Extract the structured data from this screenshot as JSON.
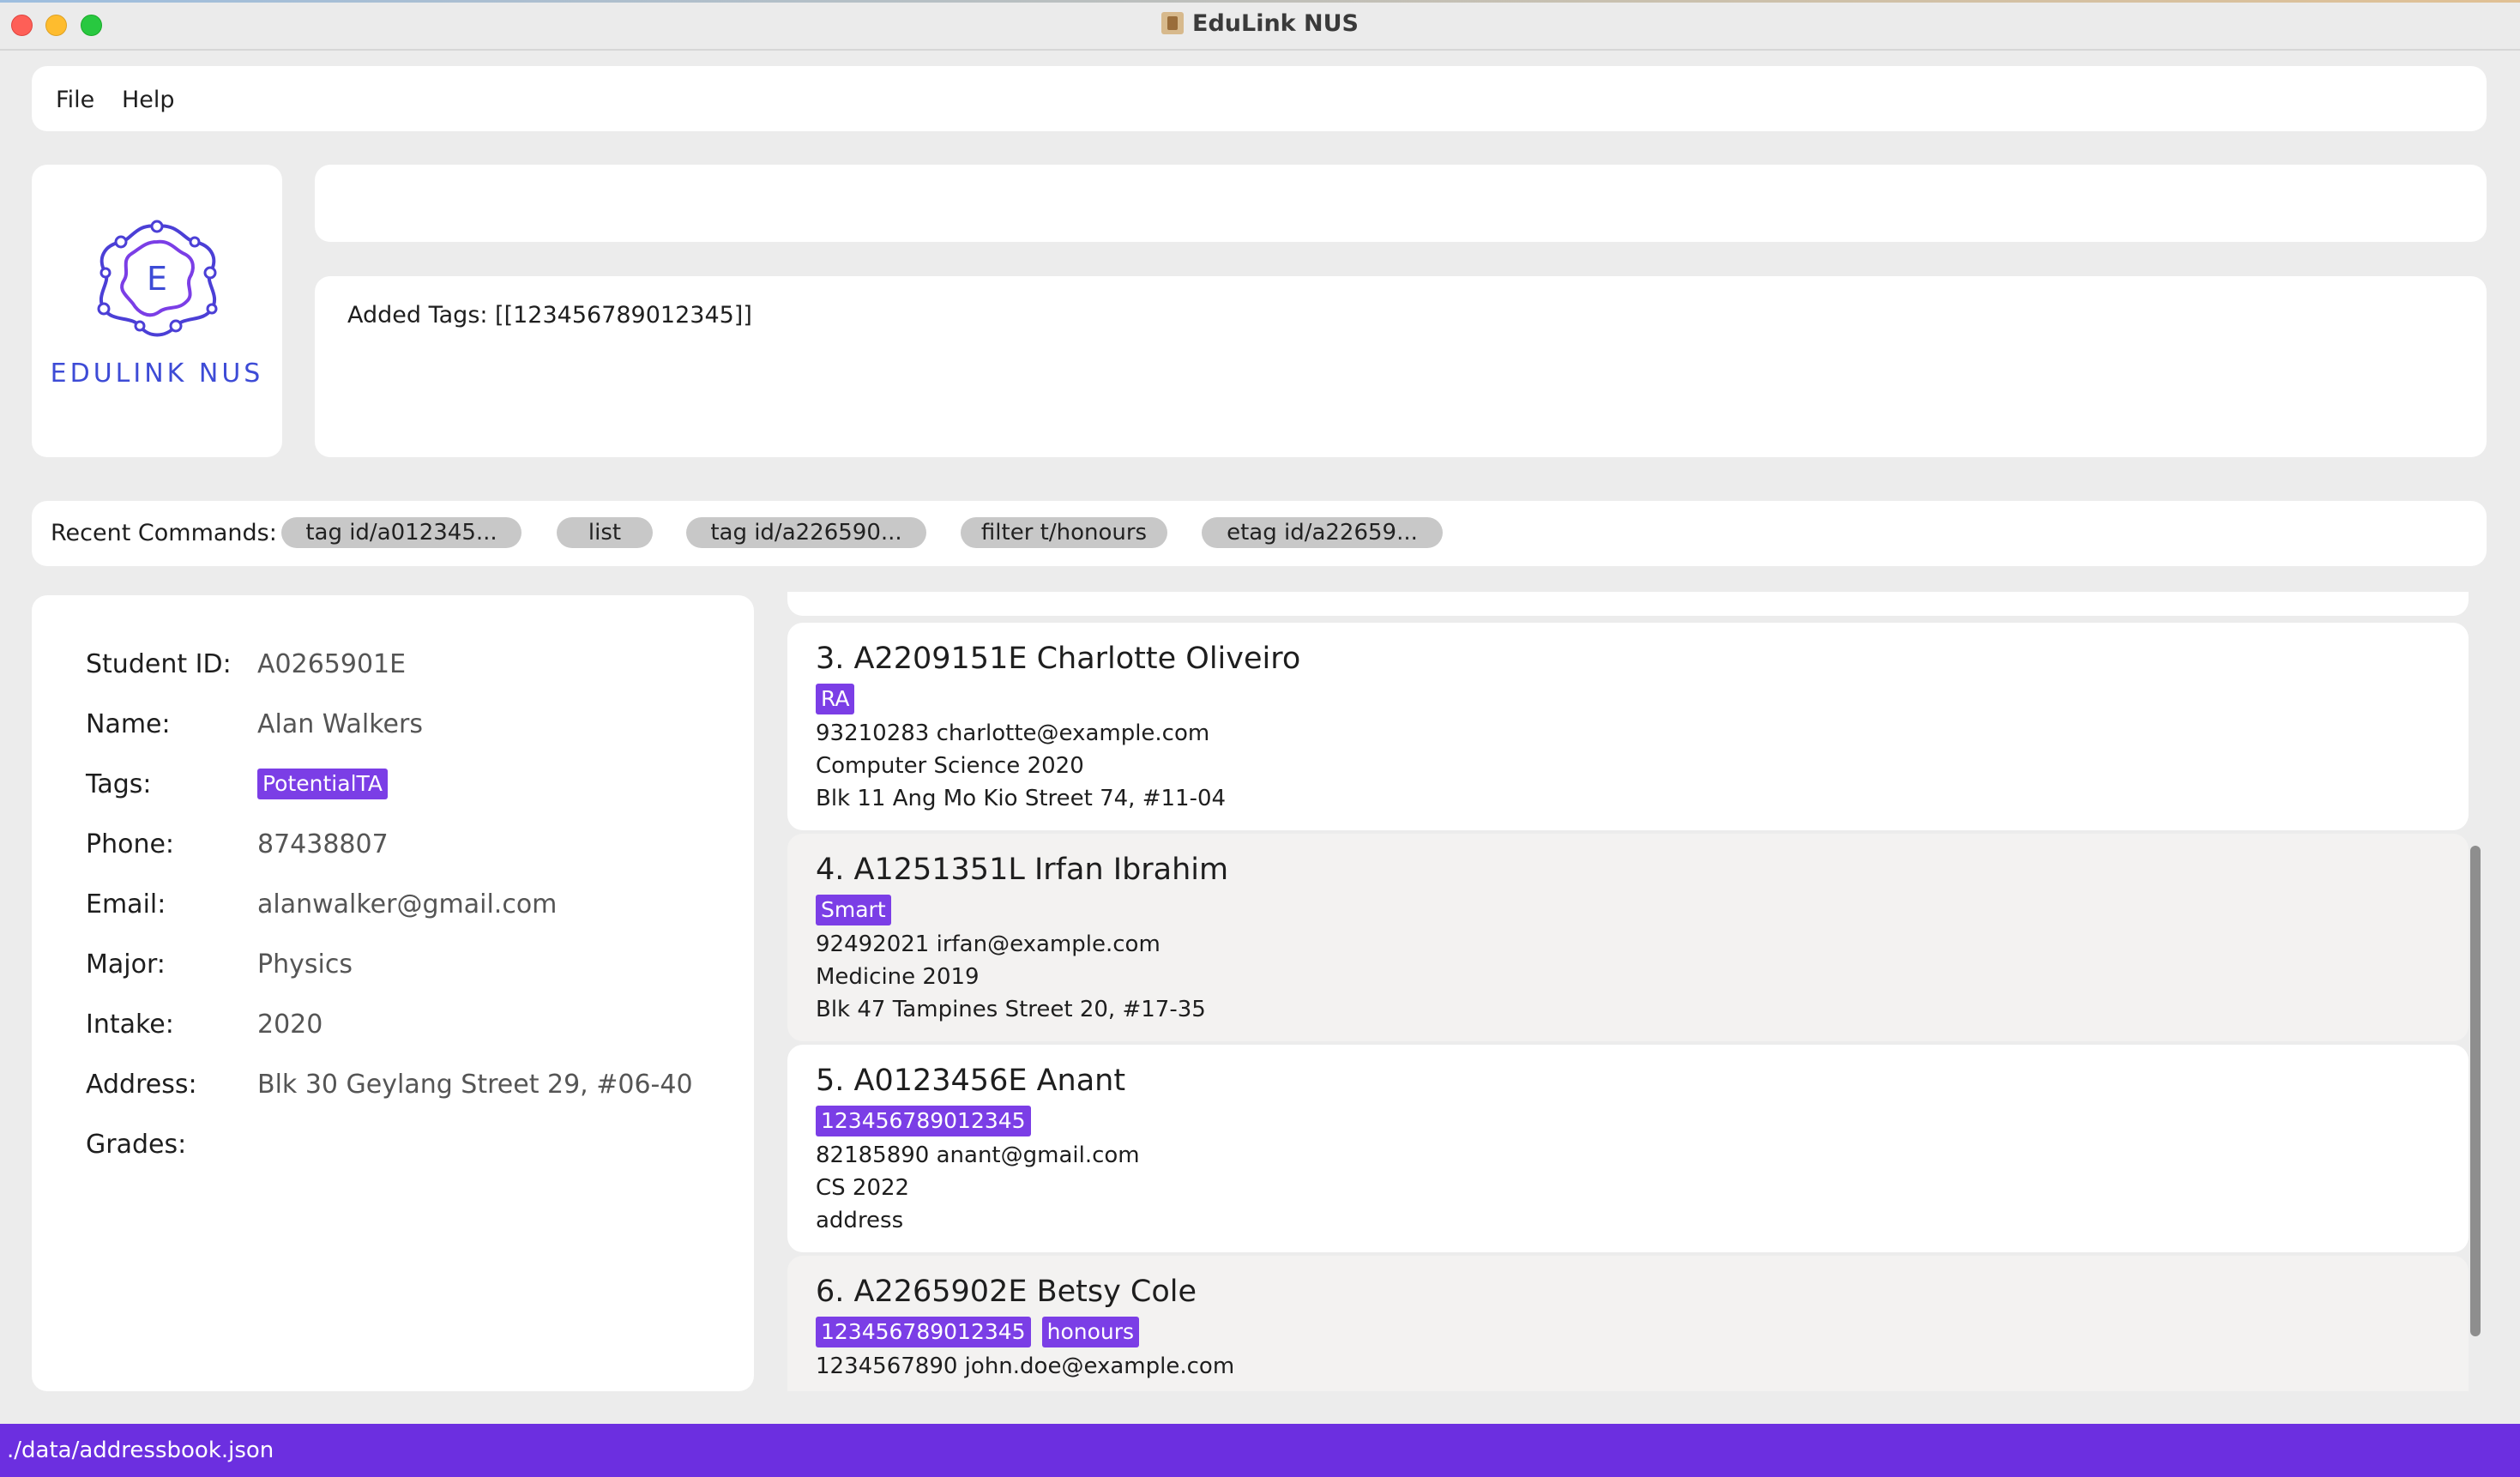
{
  "window": {
    "title": "EduLink NUS"
  },
  "menu": {
    "file": "File",
    "help": "Help"
  },
  "logo": {
    "letter": "E",
    "text": "EDULINK NUS"
  },
  "command": {
    "value": ""
  },
  "result": {
    "text": "Added Tags: [[123456789012345]]"
  },
  "recent": {
    "label": "Recent Commands:",
    "chips": [
      "tag id/a012345...",
      "list",
      "tag id/a226590...",
      "filter t/honours",
      "etag id/a22659..."
    ]
  },
  "detail": {
    "labels": {
      "student_id": "Student ID:",
      "name": "Name:",
      "tags": "Tags:",
      "phone": "Phone:",
      "email": "Email:",
      "major": "Major:",
      "intake": "Intake:",
      "address": "Address:",
      "grades": "Grades:"
    },
    "values": {
      "student_id": "A0265901E",
      "name": "Alan Walkers",
      "tag": "PotentialTA",
      "phone": "87438807",
      "email": "alanwalker@gmail.com",
      "major": "Physics",
      "intake": "2020",
      "address": "Blk 30 Geylang Street 29, #06-40",
      "grades": ""
    }
  },
  "cards": [
    {
      "title": "3.  A2209151E Charlotte Oliveiro",
      "tags": [
        "RA"
      ],
      "contact": "93210283  charlotte@example.com",
      "study": "Computer Science  2020",
      "address": "Blk 11 Ang Mo Kio Street 74, #11-04"
    },
    {
      "title": "4.  A1251351L Irfan Ibrahim",
      "tags": [
        "Smart"
      ],
      "contact": "92492021  irfan@example.com",
      "study": "Medicine  2019",
      "address": "Blk 47 Tampines Street 20, #17-35"
    },
    {
      "title": "5.  A0123456E Anant",
      "tags": [
        "123456789012345"
      ],
      "contact": "82185890  anant@gmail.com",
      "study": "CS  2022",
      "address": "address"
    },
    {
      "title": "6.  A2265902E Betsy Cole",
      "tags": [
        "123456789012345",
        "honours"
      ],
      "contact": "1234567890  john.doe@example.com",
      "study": "",
      "address": ""
    }
  ],
  "status": {
    "path": "./data/addressbook.json"
  },
  "colors": {
    "accent": "#7b3ee6",
    "status_bar": "#6c2fe0",
    "logo": "#3d4bd6"
  }
}
